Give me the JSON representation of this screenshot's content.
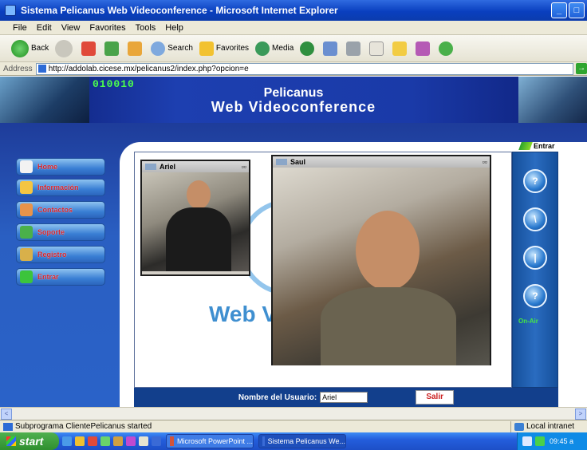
{
  "window": {
    "title": "Sistema Pelicanus Web Videoconference - Microsoft Internet Explorer",
    "min_glyph": "_",
    "max_glyph": "□"
  },
  "menu": [
    "File",
    "Edit",
    "View",
    "Favorites",
    "Tools",
    "Help"
  ],
  "toolbar": {
    "back_label": "Back",
    "search_label": "Search",
    "favorites_label": "Favorites",
    "media_label": "Media"
  },
  "address": {
    "label": "Address",
    "url": "http://addolab.cicese.mx/pelicanus2/index.php?opcion=e",
    "go_glyph": "→"
  },
  "banner": {
    "digits": "010010",
    "title_line1": "Pelicanus",
    "title_line2": "Web Videoconference"
  },
  "top_link": {
    "label": "Entrar"
  },
  "nav": [
    {
      "label": "Home",
      "icon_color": "#f2f2f2"
    },
    {
      "label": "Información",
      "icon_color": "#f4c542"
    },
    {
      "label": "Contactos",
      "icon_color": "#e8934a"
    },
    {
      "label": "Soporte",
      "icon_color": "#4ab04a"
    },
    {
      "label": "Registro",
      "icon_color": "#d8b04a"
    },
    {
      "label": "Entrar",
      "icon_color": "#3cc43c"
    }
  ],
  "applet": {
    "logo_text": "Web Vi",
    "video_small": {
      "name": "Ariel",
      "ctrl_glyphs": "▫▫"
    },
    "video_large": {
      "name": "Saul",
      "ctrl_glyphs": "▫▫"
    },
    "side_buttons": [
      "?",
      "\\",
      "|",
      "?"
    ],
    "online_label": "On-Air"
  },
  "userbar": {
    "label": "Nombre del Usuario:",
    "value": "Ariel",
    "exit_label": "Salir"
  },
  "scrollbar": {
    "left_glyph": "<",
    "right_glyph": ">"
  },
  "status": {
    "text": "Subprograma ClientePelicanus started",
    "zone": "Local intranet"
  },
  "taskbar": {
    "start_label": "start",
    "tasks": [
      {
        "label": "Microsoft PowerPoint ...",
        "icon_color": "#d3543a"
      },
      {
        "label": "Sistema Pelicanus We...",
        "icon_color": "#3a6bd6"
      }
    ],
    "clock": "09:45 a"
  },
  "colors": {
    "title_blue": "#0a3fbf",
    "page_blue": "#2a5fc2",
    "nav_label_red": "#d3212a",
    "online_green": "#45e845",
    "digits_green": "#4cff4c"
  }
}
